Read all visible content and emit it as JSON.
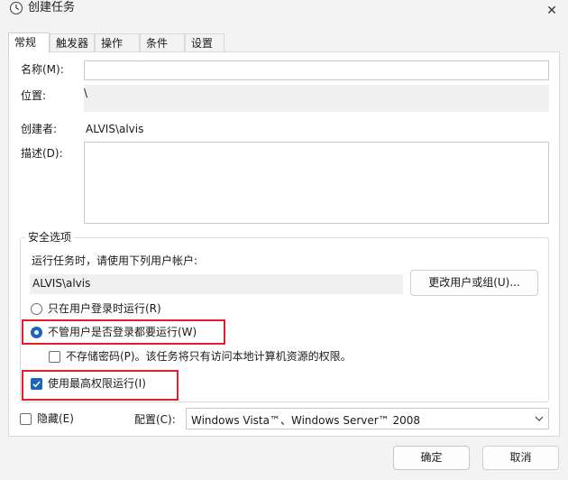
{
  "window": {
    "title": "创建任务",
    "close_glyph": "✕"
  },
  "tabs": [
    {
      "label": "常规",
      "active": true
    },
    {
      "label": "触发器",
      "active": false
    },
    {
      "label": "操作",
      "active": false
    },
    {
      "label": "条件",
      "active": false
    },
    {
      "label": "设置",
      "active": false
    }
  ],
  "general": {
    "name_label": "名称(M):",
    "name_value": "",
    "location_label": "位置:",
    "location_value": "\\",
    "author_label": "创建者:",
    "author_value": "ALVIS\\alvis",
    "description_label": "描述(D):",
    "description_value": ""
  },
  "security": {
    "group_title": "安全选项",
    "run_as_prompt": "运行任务时，请使用下列用户帐户:",
    "run_as_user": "ALVIS\\alvis",
    "change_user_button": "更改用户或组(U)...",
    "option_logged_on_only": "只在用户登录时运行(R)",
    "option_whether_logged_on": "不管用户是否登录都要运行(W)",
    "selected_option": "option_whether_logged_on",
    "do_not_store_password": "不存储密码(P)。该任务将只有访问本地计算机资源的权限。",
    "do_not_store_password_checked": false,
    "run_highest_privileges": "使用最高权限运行(I)",
    "run_highest_privileges_checked": true
  },
  "footer": {
    "hidden_label": "隐藏(E)",
    "hidden_checked": false,
    "configure_label": "配置(C):",
    "configure_value": "Windows Vista™、Windows Server™ 2008"
  },
  "buttons": {
    "ok": "确定",
    "cancel": "取消"
  },
  "colors": {
    "accent": "#1a66b8",
    "highlight_box": "#e0202a",
    "panel_bg": "#ffffff",
    "window_bg": "#f3f3f3"
  }
}
